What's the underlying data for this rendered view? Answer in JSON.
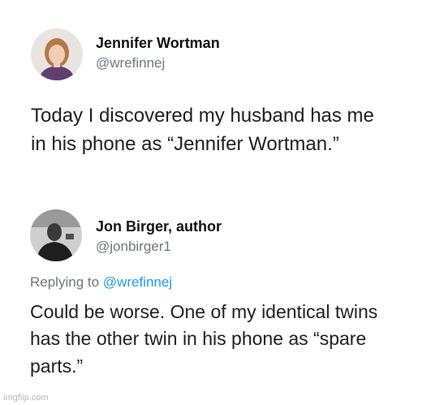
{
  "tweet": {
    "author_name": "Jennifer Wortman",
    "author_handle": "@wrefinnej",
    "text": "Today I discovered my husband has me in his phone as “Jennifer Wortman.”"
  },
  "reply": {
    "author_name": "Jon Birger, author",
    "author_handle": "@jonbirger1",
    "replying_prefix": "Replying to",
    "replying_to": "@wrefinnej",
    "text": "Could be worse. One of my identical twins has the other twin in his phone as “spare parts.”"
  },
  "watermark": "imgflip.com",
  "colors": {
    "handle_gray": "#6e767d",
    "link_blue": "#1d9bf0"
  }
}
